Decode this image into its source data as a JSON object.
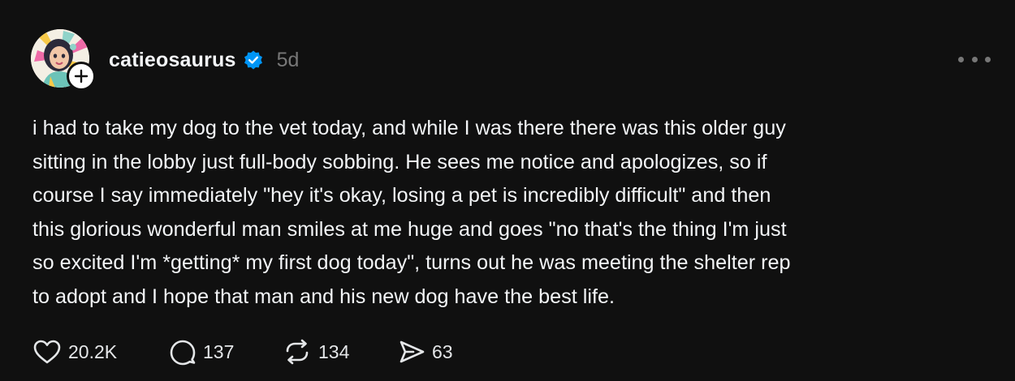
{
  "post": {
    "author": "catieosaurus",
    "time": "5d",
    "text": [
      "i had to take my dog to the vet today, and while I was there there was this older guy",
      "sitting in the lobby just full-body sobbing. He sees me notice and apologizes, so if",
      "course I say immediately \"hey it's okay, losing a pet is incredibly difficult\" and then",
      "this glorious wonderful man smiles at me huge and goes \"no that's the thing I'm just",
      "so excited I'm *getting* my first dog today\", turns out he was meeting the shelter rep",
      "to adopt and I hope that man and his new dog have the best life."
    ]
  },
  "actions": {
    "likes": "20.2K",
    "replies": "137",
    "reposts": "134",
    "shares": "63"
  },
  "icons": {
    "verified": "verified-badge-icon",
    "follow": "plus-icon",
    "more": "more-icon",
    "like": "heart-icon",
    "reply": "comment-icon",
    "repost": "repost-icon",
    "share": "send-icon"
  },
  "colors": {
    "background": "#101010",
    "text": "#f3f5f7",
    "muted": "#777777",
    "verified": "#0095f6"
  }
}
